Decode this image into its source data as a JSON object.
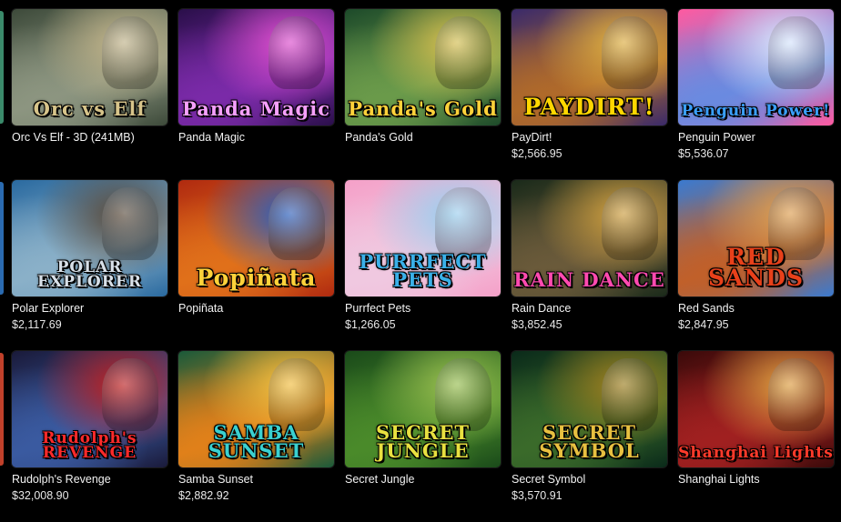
{
  "games": [
    {
      "name": "Orc Vs Elf - 3D (241MB)",
      "jackpot": "",
      "logo": "Orc vs Elf",
      "colors": [
        "#3d4a3a",
        "#8c9580",
        "#c2b48a"
      ],
      "logo_color": "#d7c48a"
    },
    {
      "name": "Panda Magic",
      "jackpot": "",
      "logo": "Panda Magic",
      "colors": [
        "#2a0f4a",
        "#7a2aa8",
        "#e04fd0"
      ],
      "logo_color": "#f7a0ff"
    },
    {
      "name": "Panda's Gold",
      "jackpot": "",
      "logo": "Panda's Gold",
      "colors": [
        "#1d4a2a",
        "#6a9a4a",
        "#d8c050"
      ],
      "logo_color": "#ffd23a"
    },
    {
      "name": "PayDirt!",
      "jackpot": "$2,566.95",
      "logo": "PAYDIRT!",
      "colors": [
        "#3a2a6a",
        "#b06a2a",
        "#e0b040"
      ],
      "logo_color": "#ffd700"
    },
    {
      "name": "Penguin Power",
      "jackpot": "$5,536.07",
      "logo": "Penguin Power!",
      "colors": [
        "#ff5aa0",
        "#6a8ae0",
        "#d8e8ff"
      ],
      "logo_color": "#3aa0ff"
    },
    {
      "name": "Polar Explorer",
      "jackpot": "$2,117.69",
      "logo": "POLAR EXPLORER",
      "colors": [
        "#2a6aa0",
        "#8ab0c8",
        "#5a4a3a"
      ],
      "logo_color": "#d8e0e8"
    },
    {
      "name": "Popiñata",
      "jackpot": "",
      "logo": "Popiñata",
      "colors": [
        "#b02a10",
        "#e0701a",
        "#2a60c0"
      ],
      "logo_color": "#ffd23a"
    },
    {
      "name": "Purrfect Pets",
      "jackpot": "$1,266.05",
      "logo": "PURRFECT PETS",
      "colors": [
        "#f5a0c8",
        "#f0c8e0",
        "#9ad0f0"
      ],
      "logo_color": "#3ab0e8"
    },
    {
      "name": "Rain Dance",
      "jackpot": "$3,852.45",
      "logo": "RAIN DANCE",
      "colors": [
        "#1a2a1a",
        "#6a5a3a",
        "#d0a040"
      ],
      "logo_color": "#ff4ab0"
    },
    {
      "name": "Red Sands",
      "jackpot": "$2,847.95",
      "logo": "RED SANDS",
      "colors": [
        "#3a7ad0",
        "#c0602a",
        "#e0a050"
      ],
      "logo_color": "#e8401a"
    },
    {
      "name": "Rudolph's Revenge",
      "jackpot": "$32,008.90",
      "logo": "Rudolph's REVENGE",
      "colors": [
        "#1a1a3a",
        "#3a5aa0",
        "#c02020"
      ],
      "logo_color": "#ff2a2a"
    },
    {
      "name": "Samba Sunset",
      "jackpot": "$2,882.92",
      "logo": "SAMBA SUNSET",
      "colors": [
        "#1a5a3a",
        "#e0801a",
        "#f5c040"
      ],
      "logo_color": "#3ad0d0"
    },
    {
      "name": "Secret Jungle",
      "jackpot": "",
      "logo": "SECRET JUNGLE",
      "colors": [
        "#1a4a1a",
        "#4a8a2a",
        "#9ac050"
      ],
      "logo_color": "#e8e040"
    },
    {
      "name": "Secret Symbol",
      "jackpot": "$3,570.91",
      "logo": "SECRET SYMBOL",
      "colors": [
        "#0a2a1a",
        "#3a6a2a",
        "#a08020"
      ],
      "logo_color": "#e8c040"
    },
    {
      "name": "Shanghai Lights",
      "jackpot": "",
      "logo": "Shanghai Lights",
      "colors": [
        "#3a0a0a",
        "#a02020",
        "#e0a040"
      ],
      "logo_color": "#ff3a2a"
    }
  ],
  "edge_strips": [
    "#3a8a6a",
    "#2a6ab0",
    "#c0402a"
  ]
}
